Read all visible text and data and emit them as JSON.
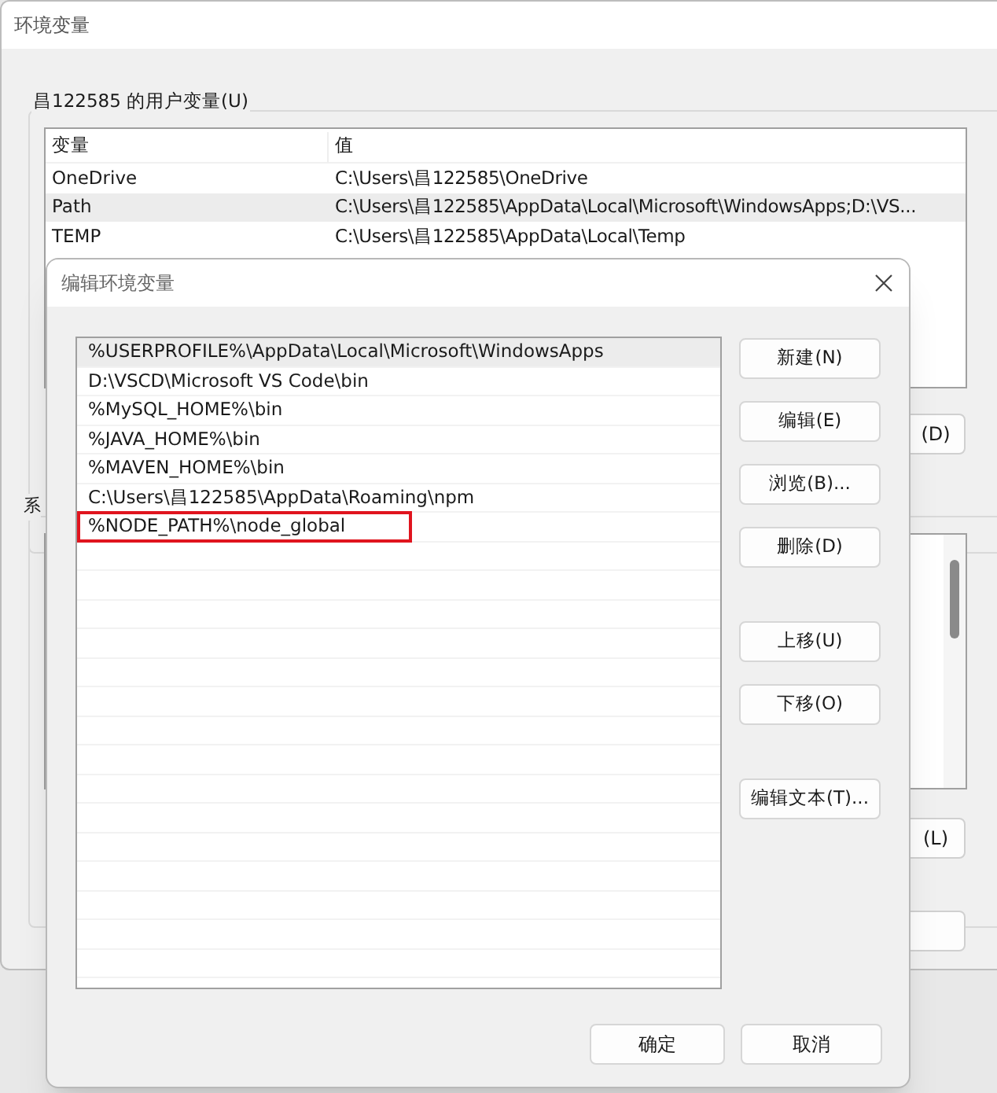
{
  "background_window": {
    "title": "环境变量",
    "user_group": {
      "label": "昌122585 的用户变量(U)",
      "columns": [
        "变量",
        "值"
      ],
      "rows": [
        {
          "variable": "OneDrive",
          "value": "C:\\Users\\昌122585\\OneDrive",
          "selected": false
        },
        {
          "variable": "Path",
          "value": "C:\\Users\\昌122585\\AppData\\Local\\Microsoft\\WindowsApps;D:\\VS...",
          "selected": true
        },
        {
          "variable": "TEMP",
          "value": "C:\\Users\\昌122585\\AppData\\Local\\Temp",
          "selected": false
        }
      ],
      "button": "(D)"
    },
    "system_group": {
      "label": "系",
      "button": "(L)"
    }
  },
  "dialog": {
    "title": "编辑环境变量",
    "entries": [
      {
        "text": "%USERPROFILE%\\AppData\\Local\\Microsoft\\WindowsApps",
        "selected": true,
        "highlighted": false
      },
      {
        "text": "D:\\VSCD\\Microsoft VS Code\\bin",
        "selected": false,
        "highlighted": false
      },
      {
        "text": "%MySQL_HOME%\\bin",
        "selected": false,
        "highlighted": false
      },
      {
        "text": "%JAVA_HOME%\\bin",
        "selected": false,
        "highlighted": false
      },
      {
        "text": "%MAVEN_HOME%\\bin",
        "selected": false,
        "highlighted": false
      },
      {
        "text": "C:\\Users\\昌122585\\AppData\\Roaming\\npm",
        "selected": false,
        "highlighted": false
      },
      {
        "text": "%NODE_PATH%\\node_global",
        "selected": false,
        "highlighted": true
      }
    ],
    "side_button_groups": [
      [
        "新建(N)",
        "编辑(E)",
        "浏览(B)...",
        "删除(D)"
      ],
      [
        "上移(U)",
        "下移(O)"
      ],
      [
        "编辑文本(T)..."
      ]
    ],
    "footer_buttons": [
      "确定",
      "取消"
    ]
  }
}
